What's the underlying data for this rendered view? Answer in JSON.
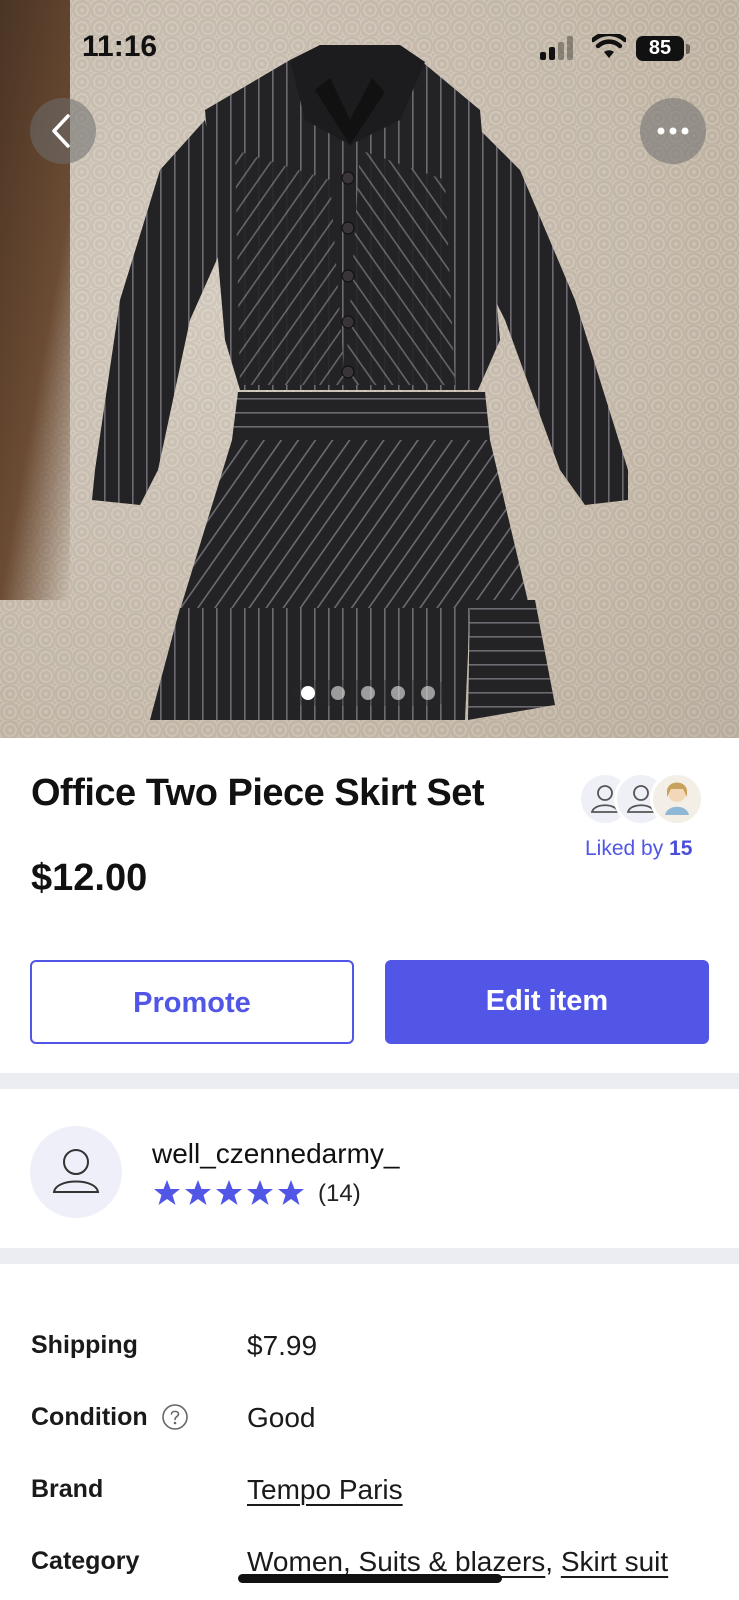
{
  "status_bar": {
    "time": "11:16",
    "battery": "85"
  },
  "gallery": {
    "image_count": 5,
    "active_index": 0
  },
  "listing": {
    "title": "Office Two Piece Skirt Set",
    "price": "$12.00"
  },
  "likes": {
    "label": "Liked by",
    "count": "15"
  },
  "actions": {
    "promote_label": "Promote",
    "edit_label": "Edit item"
  },
  "seller": {
    "username": "well_czennedarmy_",
    "rating_stars": 5,
    "review_count": "(14)"
  },
  "details": {
    "shipping_label": "Shipping",
    "shipping_value": "$7.99",
    "condition_label": "Condition",
    "condition_value": "Good",
    "brand_label": "Brand",
    "brand_value": "Tempo Paris",
    "category_label": "Category",
    "category_value_1": "Women, Suits & blazers",
    "category_sep": ",",
    "category_value_2": "Skirt suit"
  },
  "colors": {
    "accent": "#5156e6",
    "separator": "#ecedf2"
  }
}
